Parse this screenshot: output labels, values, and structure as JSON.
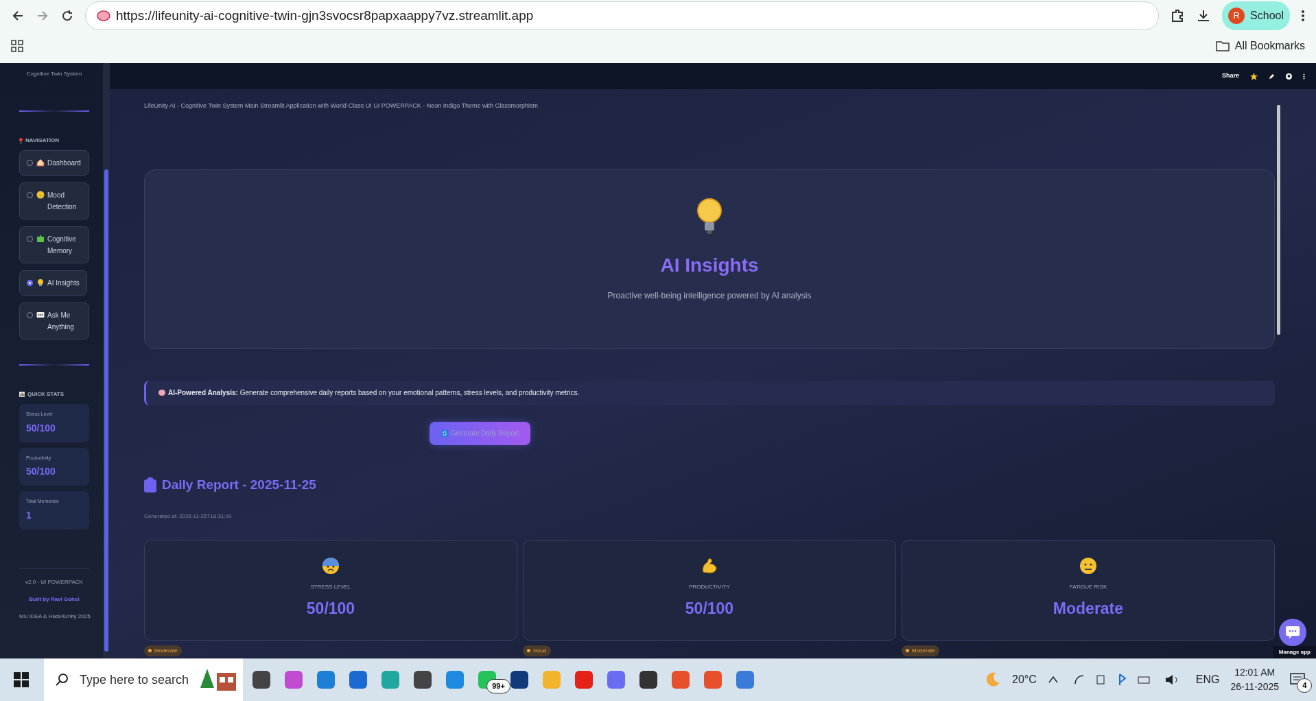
{
  "browser": {
    "url": "https://lifeunity-ai-cognitive-twin-gjn3svocsr8papxaappy7vz.streamlit.app",
    "profile_initial": "R",
    "profile_label": "School",
    "bookmarks": "All Bookmarks"
  },
  "sidebar": {
    "subtitle": "Cognitive Twin System",
    "nav_heading": "NAVIGATION",
    "nav": [
      {
        "label": "Dashboard",
        "selected": false
      },
      {
        "label": "Mood Detection",
        "selected": false
      },
      {
        "label": "Cognitive Memory",
        "selected": false
      },
      {
        "label": "AI Insights",
        "selected": true
      },
      {
        "label": "Ask Me Anything",
        "selected": false
      }
    ],
    "stats_heading": "QUICK STATS",
    "stats": [
      {
        "label": "Stress Level",
        "value": "50/100"
      },
      {
        "label": "Productivity",
        "value": "50/100"
      },
      {
        "label": "Total Memories",
        "value": "1"
      }
    ],
    "footer": [
      "v2.0 - UI POWERPACK",
      "Built by Ravi Gohel",
      "MU IDEA & Hack4Unity 2025"
    ]
  },
  "toolbar": {
    "share": "Share"
  },
  "caption": "LifeUnity AI - Cognitive Twin System Main Streamlit Application with World-Class UI UI POWERPACK - Neon Indigo Theme with Glassmorphism",
  "hero": {
    "title": "AI Insights",
    "subtitle": "Proactive well-being intelligence powered by AI analysis"
  },
  "info": "**AI-Powered Analysis:** Generate comprehensive daily reports based on your emotional patterns, stress levels, and productivity metrics.",
  "button": "Generate Daily Report",
  "report": {
    "title": "Daily Report - 2025-11-25",
    "generated": "Generated at: 2025-11-25T18:31:00",
    "cards": [
      {
        "label": "STRESS LEVEL",
        "value": "50/100",
        "badge": "Moderate"
      },
      {
        "label": "PRODUCTIVITY",
        "value": "50/100",
        "badge": "Good"
      },
      {
        "label": "FATIGUE RISK",
        "value": "Moderate",
        "badge": "Moderate"
      }
    ]
  },
  "manage_app": "Manage app",
  "taskbar": {
    "search_placeholder": "Type here to search",
    "whatsapp_badge": "99+",
    "temperature": "20°C",
    "language": "ENG",
    "time": "12:01 AM",
    "date": "26-11-2025",
    "notifications": "4"
  }
}
